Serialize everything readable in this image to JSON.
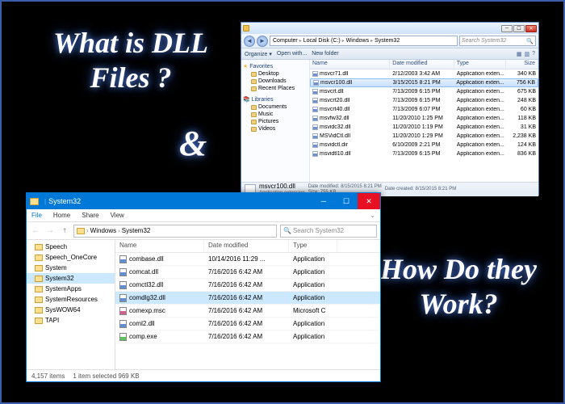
{
  "headlines": {
    "h1": "What is DLL Files ?",
    "amp": "&",
    "h2": "How Do they Work?"
  },
  "win7": {
    "breadcrumbs": [
      "Computer",
      "Local Disk (C:)",
      "Windows",
      "System32"
    ],
    "search_placeholder": "Search System32",
    "toolbar": {
      "organize": "Organize ▾",
      "openwith": "Open with...",
      "newfolder": "New folder"
    },
    "nav": {
      "favorites": {
        "label": "Favorites",
        "items": [
          "Desktop",
          "Downloads",
          "Recent Places"
        ]
      },
      "libraries": {
        "label": "Libraries",
        "items": [
          "Documents",
          "Music",
          "Pictures",
          "Videos"
        ]
      }
    },
    "columns": {
      "name": "Name",
      "modified": "Date modified",
      "type": "Type",
      "size": "Size"
    },
    "files": [
      {
        "name": "msvcr71.dll",
        "date": "2/12/2003 3:42 AM",
        "type": "Application exten...",
        "size": "340 KB",
        "sel": false
      },
      {
        "name": "msvcr100.dll",
        "date": "3/15/2015 8:21 PM",
        "type": "Application exten...",
        "size": "756 KB",
        "sel": true
      },
      {
        "name": "msvcrt.dll",
        "date": "7/13/2009 6:15 PM",
        "type": "Application exten...",
        "size": "675 KB",
        "sel": false
      },
      {
        "name": "msvcrt20.dll",
        "date": "7/13/2009 6:15 PM",
        "type": "Application exten...",
        "size": "248 KB",
        "sel": false
      },
      {
        "name": "msvcrt40.dll",
        "date": "7/13/2009 6:07 PM",
        "type": "Application exten...",
        "size": "60 KB",
        "sel": false
      },
      {
        "name": "msvfw32.dll",
        "date": "11/20/2010 1:25 PM",
        "type": "Application exten...",
        "size": "118 KB",
        "sel": false
      },
      {
        "name": "msvidc32.dll",
        "date": "11/20/2010 1:19 PM",
        "type": "Application exten...",
        "size": "31 KB",
        "sel": false
      },
      {
        "name": "MSVidCtl.dll",
        "date": "11/20/2010 1:29 PM",
        "type": "Application exten...",
        "size": "2,238 KB",
        "sel": false
      },
      {
        "name": "msvidctl.dir",
        "date": "6/10/2009 2:21 PM",
        "type": "Application exten...",
        "size": "124 KB",
        "sel": false
      },
      {
        "name": "msvidtl10.dll",
        "date": "7/13/2009 6:15 PM",
        "type": "Application exten...",
        "size": "836 KB",
        "sel": false
      }
    ],
    "details": {
      "name": "msvcr100.dll",
      "type": "Application extension",
      "modified_label": "Date modified:",
      "modified": "8/15/2015 8:21 PM",
      "size_label": "Size:",
      "size": "755 KB",
      "created_label": "Date created:",
      "created": "8/15/2015 8:21 PM"
    }
  },
  "win10": {
    "title": "System32",
    "menus": {
      "file": "File",
      "home": "Home",
      "share": "Share",
      "view": "View"
    },
    "breadcrumbs": [
      "Windows",
      "System32"
    ],
    "search_placeholder": "Search System32",
    "tree": [
      {
        "label": "Speech",
        "sel": false
      },
      {
        "label": "Speech_OneCore",
        "sel": false
      },
      {
        "label": "System",
        "sel": false
      },
      {
        "label": "System32",
        "sel": true
      },
      {
        "label": "SystemApps",
        "sel": false
      },
      {
        "label": "SystemResources",
        "sel": false
      },
      {
        "label": "SysWOW64",
        "sel": false
      },
      {
        "label": "TAPI",
        "sel": false
      }
    ],
    "columns": {
      "name": "Name",
      "modified": "Date modified",
      "type": "Type"
    },
    "files": [
      {
        "name": "combase.dll",
        "date": "10/14/2016 11:29 ...",
        "type": "Application",
        "sel": false,
        "kind": "dll"
      },
      {
        "name": "comcat.dll",
        "date": "7/16/2016 6:42 AM",
        "type": "Application",
        "sel": false,
        "kind": "dll"
      },
      {
        "name": "comctl32.dll",
        "date": "7/16/2016 6:42 AM",
        "type": "Application",
        "sel": false,
        "kind": "dll"
      },
      {
        "name": "comdlg32.dll",
        "date": "7/16/2016 6:42 AM",
        "type": "Application",
        "sel": true,
        "kind": "dll"
      },
      {
        "name": "comexp.msc",
        "date": "7/16/2016 6:42 AM",
        "type": "Microsoft C",
        "sel": false,
        "kind": "msc"
      },
      {
        "name": "coml2.dll",
        "date": "7/16/2016 6:42 AM",
        "type": "Application",
        "sel": false,
        "kind": "dll"
      },
      {
        "name": "comp.exe",
        "date": "7/16/2016 6:42 AM",
        "type": "Application",
        "sel": false,
        "kind": "exe"
      }
    ],
    "status": {
      "items": "4,157 items",
      "selected": "1 item selected  969 KB"
    }
  }
}
